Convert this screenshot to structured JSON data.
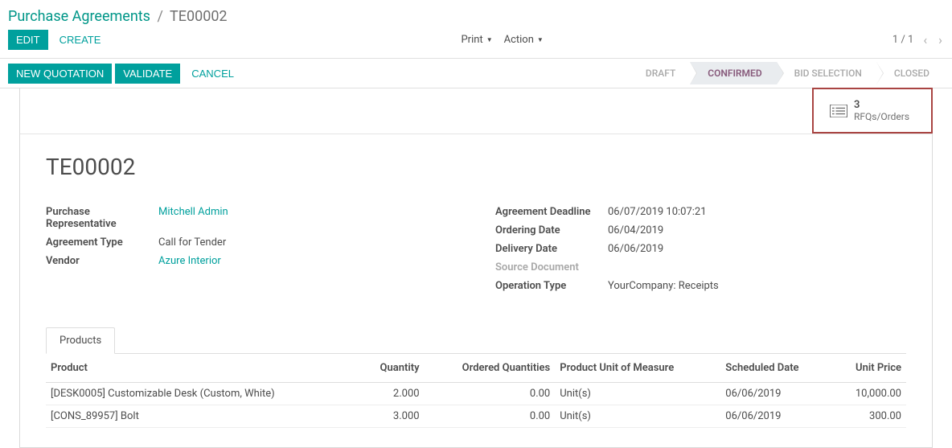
{
  "breadcrumb": {
    "root": "Purchase Agreements",
    "current": "TE00002"
  },
  "toolbar": {
    "edit": "EDIT",
    "create": "CREATE",
    "print": "Print",
    "action": "Action",
    "pager": "1 / 1"
  },
  "actions": {
    "new_quotation": "NEW QUOTATION",
    "validate": "VALIDATE",
    "cancel": "CANCEL"
  },
  "status": {
    "steps": [
      "DRAFT",
      "CONFIRMED",
      "BID SELECTION",
      "CLOSED"
    ],
    "active_index": 1
  },
  "stat": {
    "count": "3",
    "label": "RFQs/Orders"
  },
  "title": "TE00002",
  "fields_left": {
    "purchase_rep_label": "Purchase Representative",
    "purchase_rep_value": "Mitchell Admin",
    "agreement_type_label": "Agreement Type",
    "agreement_type_value": "Call for Tender",
    "vendor_label": "Vendor",
    "vendor_value": "Azure Interior"
  },
  "fields_right": {
    "deadline_label": "Agreement Deadline",
    "deadline_value": "06/07/2019 10:07:21",
    "ordering_label": "Ordering Date",
    "ordering_value": "06/04/2019",
    "delivery_label": "Delivery Date",
    "delivery_value": "06/06/2019",
    "source_label": "Source Document",
    "source_value": "",
    "operation_label": "Operation Type",
    "operation_value": "YourCompany: Receipts"
  },
  "tabs": {
    "products": "Products"
  },
  "table": {
    "headers": {
      "product": "Product",
      "quantity": "Quantity",
      "ordered": "Ordered Quantities",
      "uom": "Product Unit of Measure",
      "scheduled": "Scheduled Date",
      "unit_price": "Unit Price"
    },
    "rows": [
      {
        "product": "[DESK0005] Customizable Desk (Custom, White)",
        "quantity": "2.000",
        "ordered": "0.00",
        "uom": "Unit(s)",
        "scheduled": "06/06/2019",
        "unit_price": "10,000.00"
      },
      {
        "product": "[CONS_89957] Bolt",
        "quantity": "3.000",
        "ordered": "0.00",
        "uom": "Unit(s)",
        "scheduled": "06/06/2019",
        "unit_price": "300.00"
      }
    ]
  }
}
